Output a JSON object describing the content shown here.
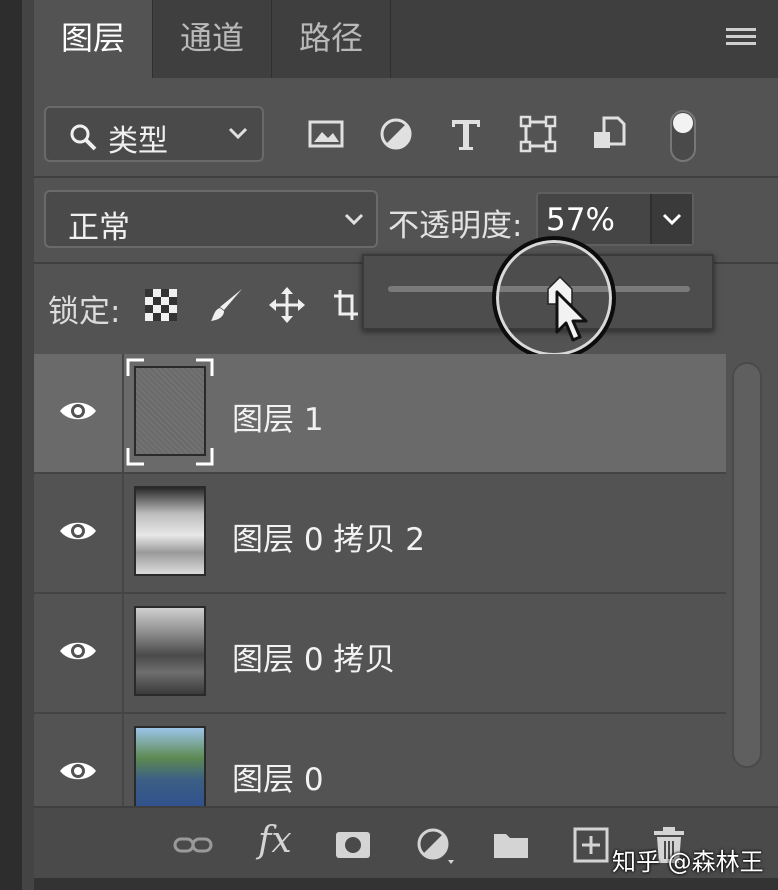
{
  "tabs": [
    {
      "label": "图层",
      "active": true
    },
    {
      "label": "通道",
      "active": false
    },
    {
      "label": "路径",
      "active": false
    }
  ],
  "filter": {
    "label": "类型",
    "icons": [
      "image-filter-icon",
      "adjustment-filter-icon",
      "type-filter-icon",
      "shape-filter-icon",
      "smart-object-filter-icon"
    ],
    "toggle_on": true
  },
  "blend": {
    "mode": "正常",
    "opacity_label": "不透明度:",
    "opacity_value": "57%",
    "opacity_fraction": 0.57
  },
  "lock": {
    "label": "锁定:",
    "icons": [
      "lock-transparent-pixels-icon",
      "lock-image-pixels-icon",
      "lock-position-icon",
      "lock-artboard-icon"
    ]
  },
  "layers": [
    {
      "name": "图层 1",
      "selected": true,
      "visible": true,
      "thumb": "noise-gray"
    },
    {
      "name": "图层 0 拷贝 2",
      "selected": false,
      "visible": true,
      "thumb": "bw-high-contrast"
    },
    {
      "name": "图层 0 拷贝",
      "selected": false,
      "visible": true,
      "thumb": "bw-street"
    },
    {
      "name": "图层 0",
      "selected": false,
      "visible": true,
      "thumb": "color-street"
    }
  ],
  "bottom": {
    "icons": [
      "link-layers-icon",
      "fx-icon",
      "add-mask-icon",
      "adjustment-layer-icon",
      "new-group-icon",
      "new-layer-icon",
      "delete-layer-icon"
    ],
    "fx_label": "fx"
  },
  "watermark": "知乎 @森林王",
  "colors": {
    "panel": "#535353",
    "selected_row": "#6a6a6a",
    "tabbar": "#3f3f3f"
  }
}
